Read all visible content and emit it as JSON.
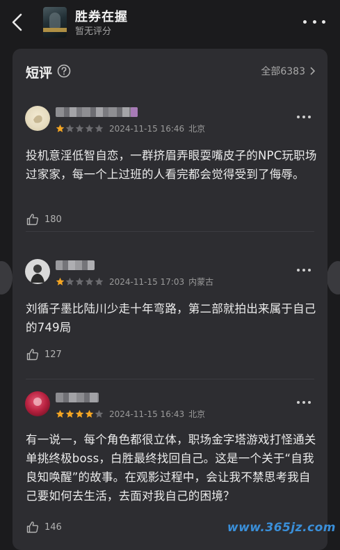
{
  "header": {
    "title": "胜券在握",
    "subtitle": "暂无评分"
  },
  "section": {
    "title": "短评",
    "all_label": "全部6383"
  },
  "reviews": [
    {
      "stars": 1,
      "time": "2024-11-15 16:46",
      "location": "北京",
      "text": "投机意淫低智自恋，一群挤眉弄眼耍嘴皮子的NPC玩职场过家家，每一个上过班的人看完都会觉得受到了侮辱。",
      "likes": "180"
    },
    {
      "stars": 1,
      "time": "2024-11-15 17:03",
      "location": "内蒙古",
      "text": "刘循子墨比陆川少走十年弯路，第二部就拍出来属于自己的749局",
      "likes": "127"
    },
    {
      "stars": 4,
      "time": "2024-11-15 16:43",
      "location": "北京",
      "text": "有一说一，每个角色都很立体，职场金字塔游戏打怪通关单挑终极boss，白胜最终找回自己。这是一个关于“自我良知唤醒”的故事。在观影过程中，会让我不禁思考我自己要如何去生活，去面对我自己的困境？",
      "likes": "146"
    }
  ],
  "watermark": "www.365jz.com",
  "colors": {
    "star_on": "#f5a623",
    "star_off": "#6b6b6f",
    "card_bg": "#2d2d31",
    "page_bg": "#1b1b1d"
  }
}
